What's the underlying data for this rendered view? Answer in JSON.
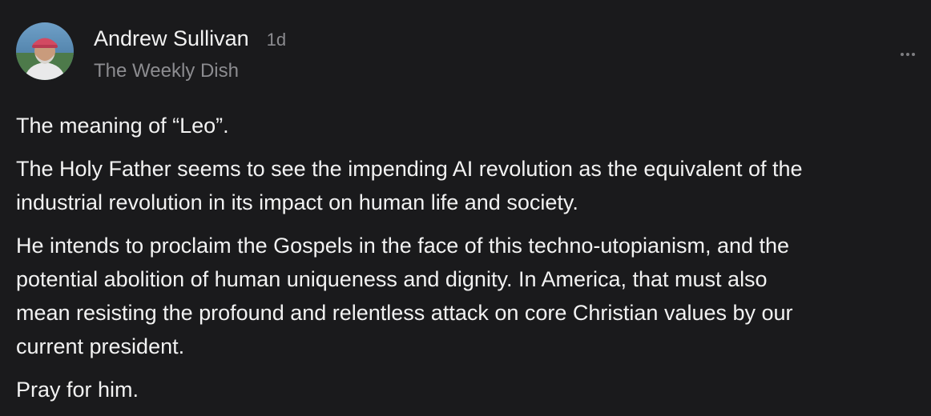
{
  "post": {
    "author": "Andrew Sullivan",
    "timestamp": "1d",
    "publication": "The Weekly Dish",
    "avatar_icon": "author-avatar-photo",
    "more_icon": "ellipsis-icon",
    "paragraphs": [
      "The meaning of “Leo”.",
      "The Holy Father seems to see the impending AI revolution as the equivalent of the\nindustrial revolution in its impact on human life and society.",
      "He intends to proclaim the Gospels in the face of this techno-utopianism, and the\npotential abolition of human uniqueness and dignity. In America, that must also\nmean resisting the profound and relentless attack on core Christian values by our\ncurrent president.",
      "Pray for him."
    ]
  },
  "colors": {
    "background": "#1a1a1c",
    "text_primary": "#f2f2f2",
    "text_secondary": "#8c8c90"
  }
}
